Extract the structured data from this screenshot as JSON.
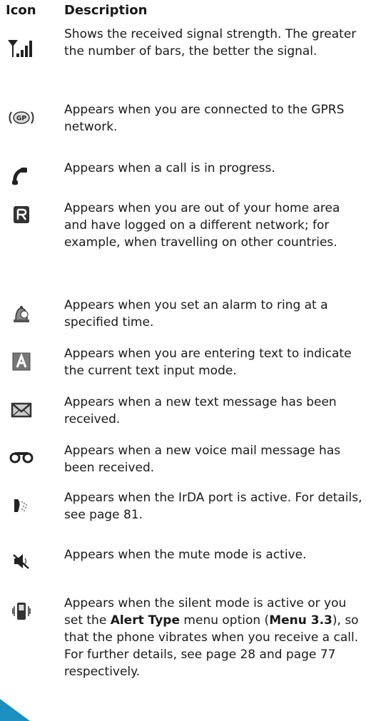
{
  "header": {
    "icon_col": "Icon",
    "desc_col": "Description"
  },
  "rows": [
    {
      "icon": "signal-strength-icon",
      "text": "Shows the received signal strength. The greater the number of bars, the better the signal."
    },
    {
      "icon": "gprs-icon",
      "text": "Appears when you are connected to the GPRS network."
    },
    {
      "icon": "call-in-progress-icon",
      "text": "Appears when a call is in progress."
    },
    {
      "icon": "roaming-icon",
      "text": "Appears when you are out of your home area and have logged on a different network; for example, when travelling on other countries."
    },
    {
      "icon": "alarm-icon",
      "text": "Appears when you set an alarm to ring at a specified time."
    },
    {
      "icon": "text-input-mode-icon",
      "text": "Appears when you are entering text to indicate the current text input mode."
    },
    {
      "icon": "new-message-icon",
      "text": "Appears when a new text message has been received."
    },
    {
      "icon": "voice-mail-icon",
      "text": "Appears when a new voice mail message has been received."
    },
    {
      "icon": "irda-icon",
      "text": "Appears when the IrDA port is active. For details, see page 81."
    },
    {
      "icon": "mute-icon",
      "text": "Appears when the mute mode is active."
    },
    {
      "icon": "silent-mode-icon",
      "parts": {
        "a": "Appears when the silent mode is active or you set the ",
        "b": "Alert Type",
        "c": " menu option (",
        "d": "Menu 3.3",
        "e": "), so that the phone vibrates when you receive a call. For further details, see page 28 and page 77 respectively."
      }
    }
  ]
}
